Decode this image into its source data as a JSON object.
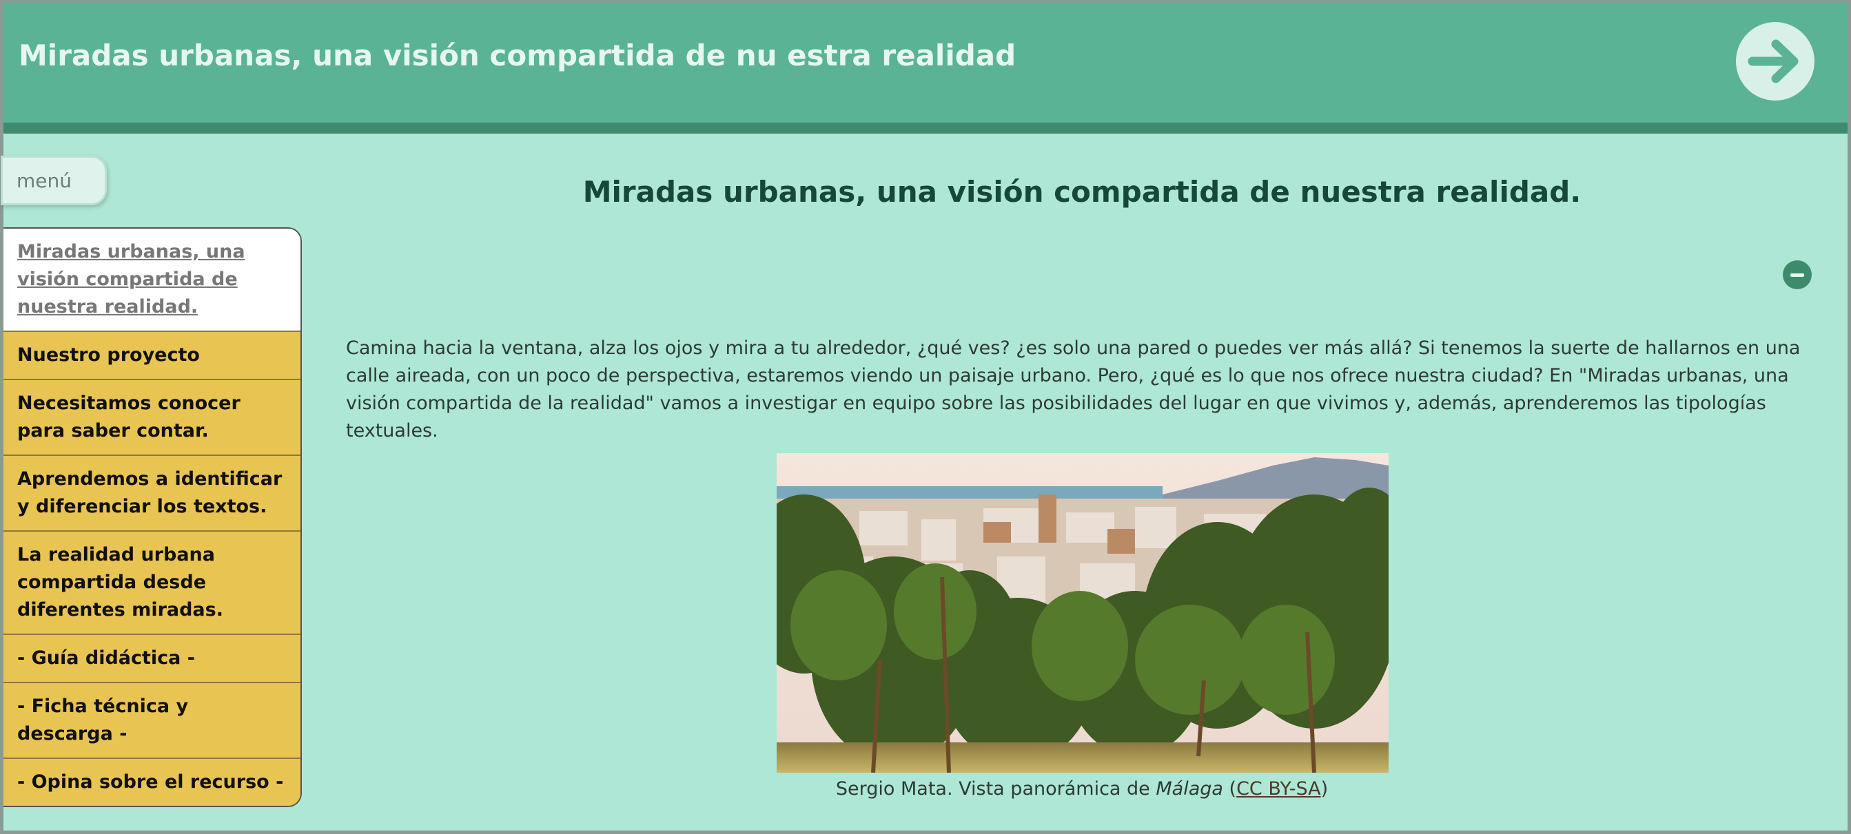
{
  "header": {
    "title": "Miradas urbanas, una visión compartida de nu estra realidad",
    "next_icon": "arrow-right-icon"
  },
  "menu": {
    "label": "menú"
  },
  "nav": {
    "items": [
      {
        "label": "Miradas urbanas, una visión compartida de nuestra realidad.",
        "active": true
      },
      {
        "label": "Nuestro proyecto"
      },
      {
        "label": "Necesitamos conocer para saber contar."
      },
      {
        "label": "Aprendemos a identificar y diferenciar los textos."
      },
      {
        "label": "La realidad urbana compartida desde diferentes miradas."
      },
      {
        "label": "- Guía didáctica -"
      },
      {
        "label": "- Ficha técnica y descarga -"
      },
      {
        "label": "- Opina sobre el recurso -"
      }
    ]
  },
  "main": {
    "title": "Miradas urbanas, una visión compartida de nuestra realidad.",
    "collapse_icon": "minus-circle-icon",
    "paragraph": "Camina hacia la ventana, alza los ojos y mira a tu alrededor, ¿qué ves? ¿es solo una pared o puedes ver más allá? Si tenemos la suerte de hallarnos en una calle aireada, con un poco de perspectiva, estaremos viendo un paisaje urbano. Pero, ¿qué es lo que nos ofrece nuestra ciudad? En \"Miradas urbanas, una visión compartida de la realidad\" vamos a investigar en equipo sobre las posibilidades del lugar en que vivimos y, además, aprenderemos las tipologías textuales.",
    "caption": {
      "prefix": "Sergio Mata. Vista panorámica de ",
      "place": "Málaga",
      "open_paren": " (",
      "license": "CC BY-SA",
      "close_paren": ")"
    }
  },
  "colors": {
    "header": "#5ab395",
    "header_bar": "#3e8a6d",
    "background": "#aee7d5",
    "nav_item": "#e8c452",
    "title_text": "#17463a"
  }
}
